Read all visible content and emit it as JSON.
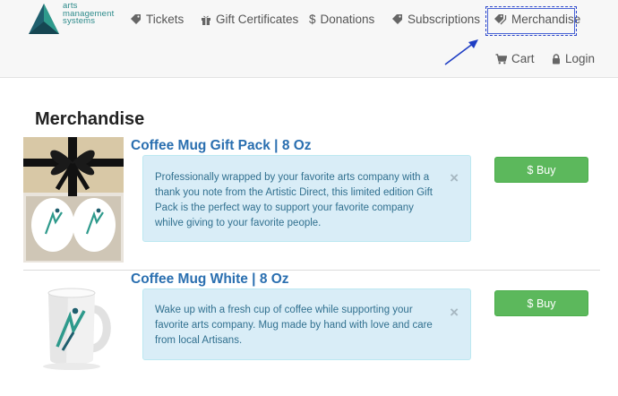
{
  "brand": {
    "line1": "arts",
    "line2": "management",
    "line3": "systems"
  },
  "nav": {
    "tickets": "Tickets",
    "gift_certificates": "Gift Certificates",
    "donations": "Donations",
    "subscriptions": "Subscriptions",
    "merchandise": "Merchandise",
    "cart": "Cart",
    "login": "Login"
  },
  "page": {
    "title": "Merchandise"
  },
  "products": [
    {
      "title": "Coffee Mug Gift Pack | 8 Oz",
      "description": "Professionally wrapped by your favorite arts company with a thank you note from the Artistic Direct, this limited edition Gift Pack is the perfect way to support your favorite company whilve giving to your favorite people.",
      "buy_label": "$ Buy",
      "close": "×"
    },
    {
      "title": "Coffee Mug White | 8 Oz",
      "description": "Wake up with a fresh cup of coffee while supporting your favorite arts company. Mug made by hand with love and care from local Artisans.",
      "buy_label": "$ Buy",
      "close": "×"
    }
  ],
  "colors": {
    "link": "#2a6fb0",
    "alert_bg": "#d9edf7",
    "alert_text": "#31708f",
    "buy": "#5cb85c",
    "annotation": "#2b46c9"
  }
}
